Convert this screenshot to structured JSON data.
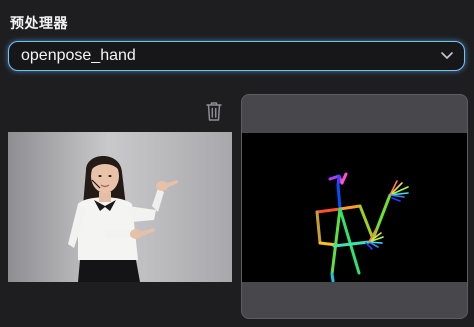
{
  "preprocessor": {
    "title": "预处理器",
    "selected": "openpose_hand"
  },
  "icons": {
    "chevron": "chevron-down-icon",
    "trash": "trash-icon"
  },
  "colors": {
    "accent": "#6ec3ff",
    "background": "#1e1e21",
    "card": "#48484c"
  }
}
